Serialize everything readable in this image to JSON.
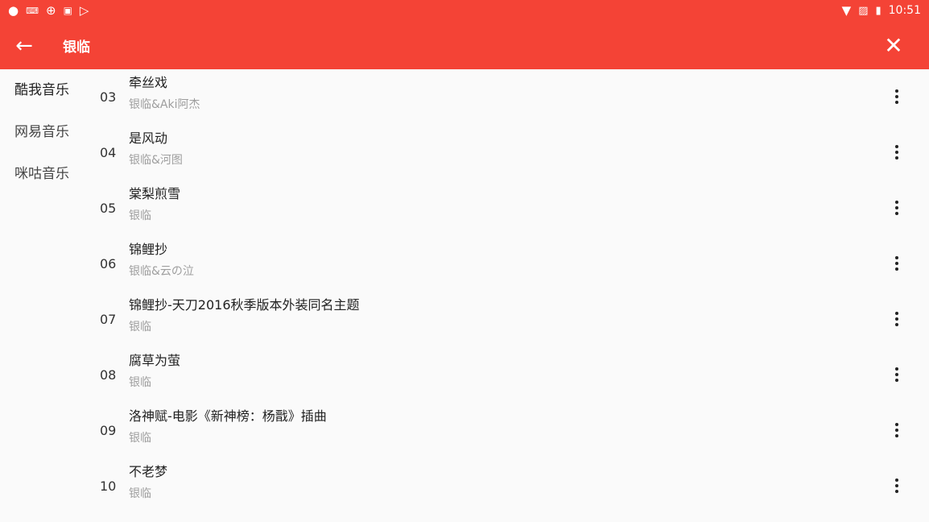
{
  "status_bar": {
    "time": "10:51",
    "left_icons": [
      "circle-icon",
      "keyboard-icon",
      "app-icon",
      "a-icon",
      "play-store-icon"
    ],
    "right_icons": [
      "wifi-icon",
      "no-sim-icon",
      "battery-icon"
    ]
  },
  "toolbar": {
    "title": "银临",
    "back_icon": "arrow-left-icon",
    "close_icon": "close-icon",
    "color": "#f44336"
  },
  "sidebar": {
    "items": [
      {
        "label": "酷我音乐"
      },
      {
        "label": "网易音乐"
      },
      {
        "label": "咪咕音乐"
      }
    ]
  },
  "tracks": [
    {
      "num": "03",
      "title": "牵丝戏",
      "artist": "银临&Aki阿杰"
    },
    {
      "num": "04",
      "title": "是风动",
      "artist": "银临&河图"
    },
    {
      "num": "05",
      "title": "棠梨煎雪",
      "artist": "银临"
    },
    {
      "num": "06",
      "title": "锦鲤抄",
      "artist": "银临&云の泣"
    },
    {
      "num": "07",
      "title": "锦鲤抄-天刀2016秋季版本外装同名主题",
      "artist": "银临"
    },
    {
      "num": "08",
      "title": "腐草为萤",
      "artist": "银临"
    },
    {
      "num": "09",
      "title": "洛神赋-电影《新神榜：杨戬》插曲",
      "artist": "银临"
    },
    {
      "num": "10",
      "title": "不老梦",
      "artist": "银临"
    }
  ]
}
